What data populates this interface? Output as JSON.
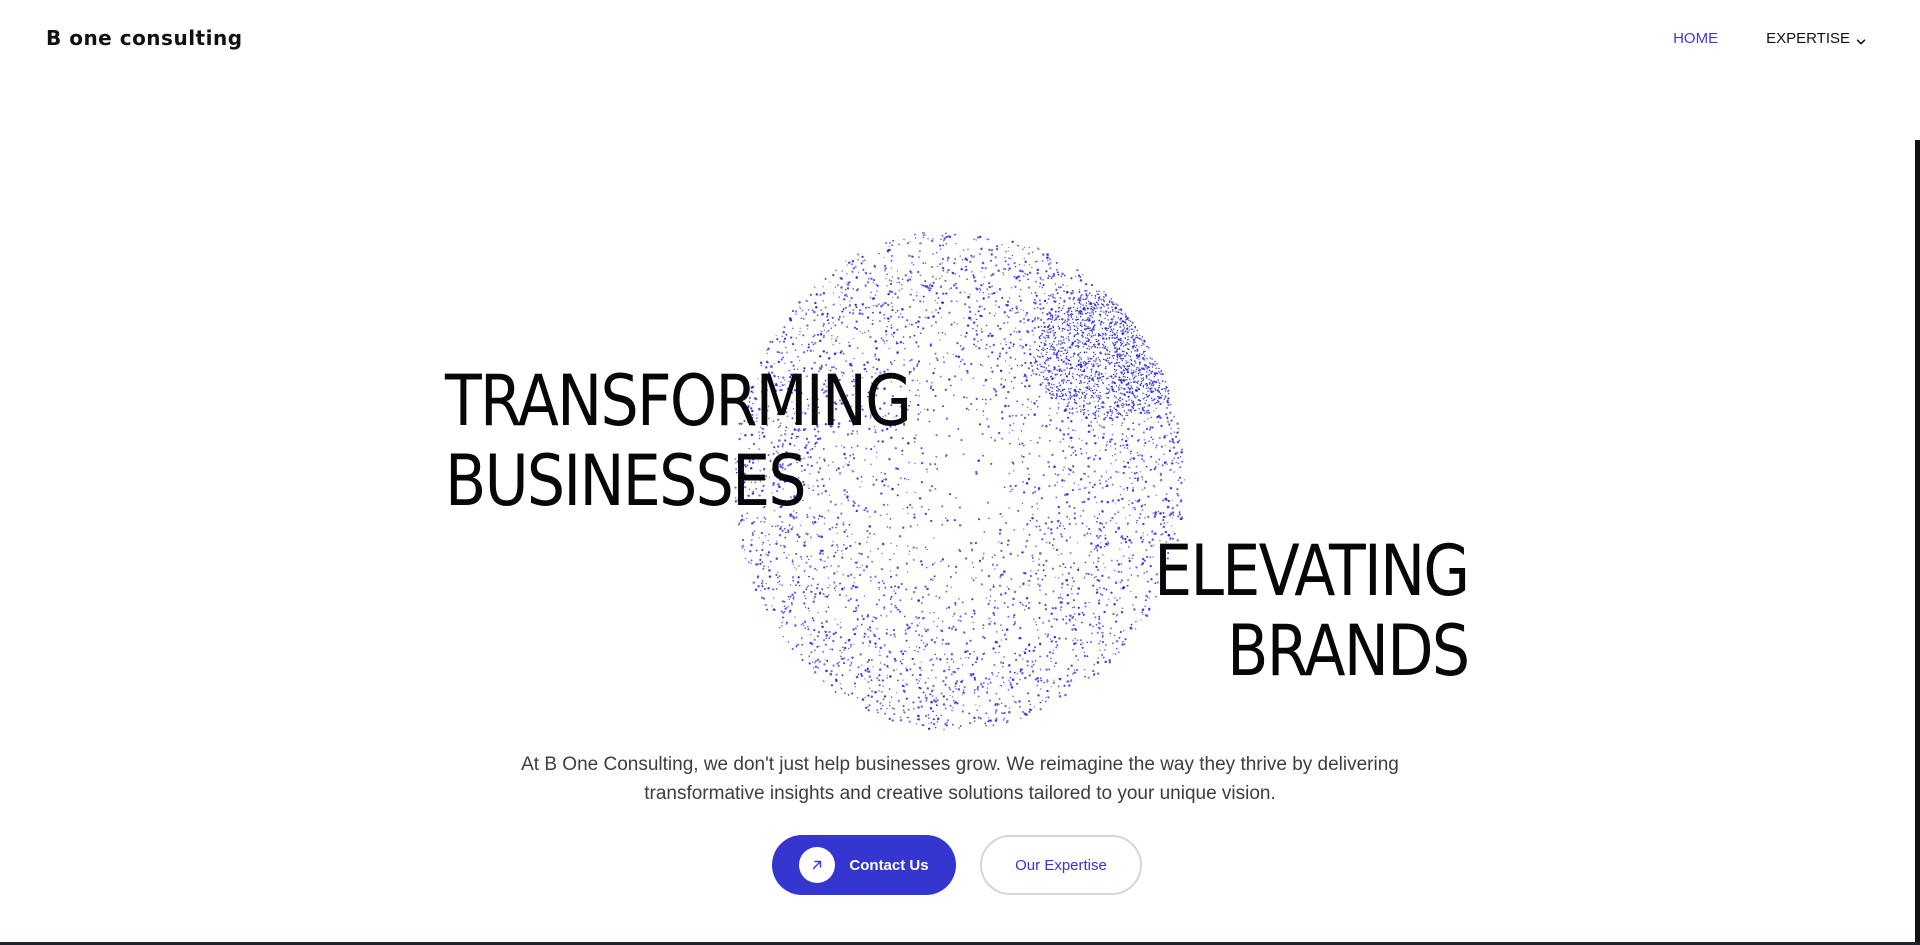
{
  "brand": {
    "logo_text": "B one consulting"
  },
  "nav": {
    "items": [
      {
        "label": "HOME",
        "active": true
      },
      {
        "label": "EXPERTISE",
        "active": false,
        "has_dropdown": true
      }
    ]
  },
  "hero": {
    "headline_left": [
      "TRANSFORMING",
      "BUSINESSES"
    ],
    "headline_right": [
      "ELEVATING",
      "BRANDS"
    ],
    "description": "At B One Consulting, we don't just help businesses grow. We reimagine the way they thrive by delivering transformative insights and creative solutions tailored to your unique vision.",
    "graphic_icon": "particle-sphere"
  },
  "cta": {
    "primary_label": "Contact Us",
    "primary_icon": "arrow-up-right-icon",
    "secondary_label": "Our Expertise"
  },
  "colors": {
    "accent": "#3535cf",
    "particles": "#2b2bd6",
    "text": "#07070a",
    "body_text": "#3a3d45",
    "background": "#ffffff"
  }
}
